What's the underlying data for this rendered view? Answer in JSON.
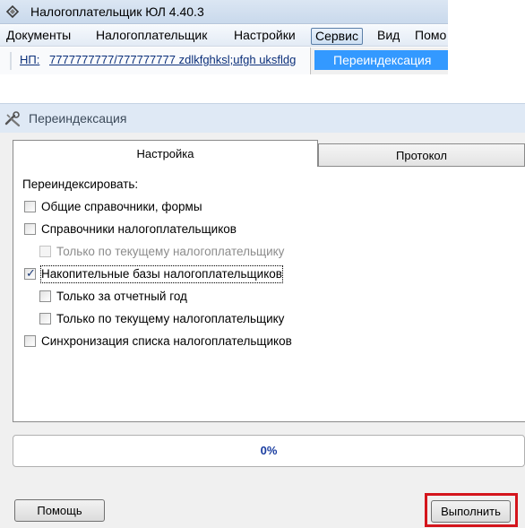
{
  "top_window": {
    "title": "Налогоплательщик ЮЛ 4.40.3",
    "menu": [
      "Документы",
      "Налогоплательщик",
      "Настройки",
      "Сервис",
      "Вид",
      "Помо"
    ],
    "selected_menu": "Сервис",
    "np_label": "НП:",
    "np_value": "7777777777/777777777 zdlkfghksl;ufgh uksfldg",
    "dropdown_item": "Переиндексация"
  },
  "dialog": {
    "title": "Переиндексация",
    "tabs": [
      "Настройка",
      "Протокол"
    ],
    "active_tab": "Настройка",
    "section_label": "Переиндексировать:",
    "options": [
      {
        "label": "Общие справочники, формы",
        "checked": false,
        "disabled": false
      },
      {
        "label": "Справочники налогоплательщиков",
        "checked": false,
        "disabled": false
      },
      {
        "label": "Только по текущему налогоплательщику",
        "checked": false,
        "disabled": true
      },
      {
        "label": "Накопительные базы налогоплательщиков",
        "checked": true,
        "disabled": false
      },
      {
        "label": "Только за отчетный год",
        "checked": false,
        "disabled": false
      },
      {
        "label": "Только по текущему налогоплательщику",
        "checked": false,
        "disabled": false
      },
      {
        "label": "Синхронизация списка налогоплательщиков",
        "checked": false,
        "disabled": false
      }
    ],
    "progress": {
      "value": 0,
      "label": "0%"
    },
    "help_button": "Помощь",
    "run_button": "Выполнить"
  },
  "colors": {
    "highlight_frame": "#d4151c",
    "menu_highlight": "#3399ff",
    "progress_text": "#1a3da0"
  }
}
